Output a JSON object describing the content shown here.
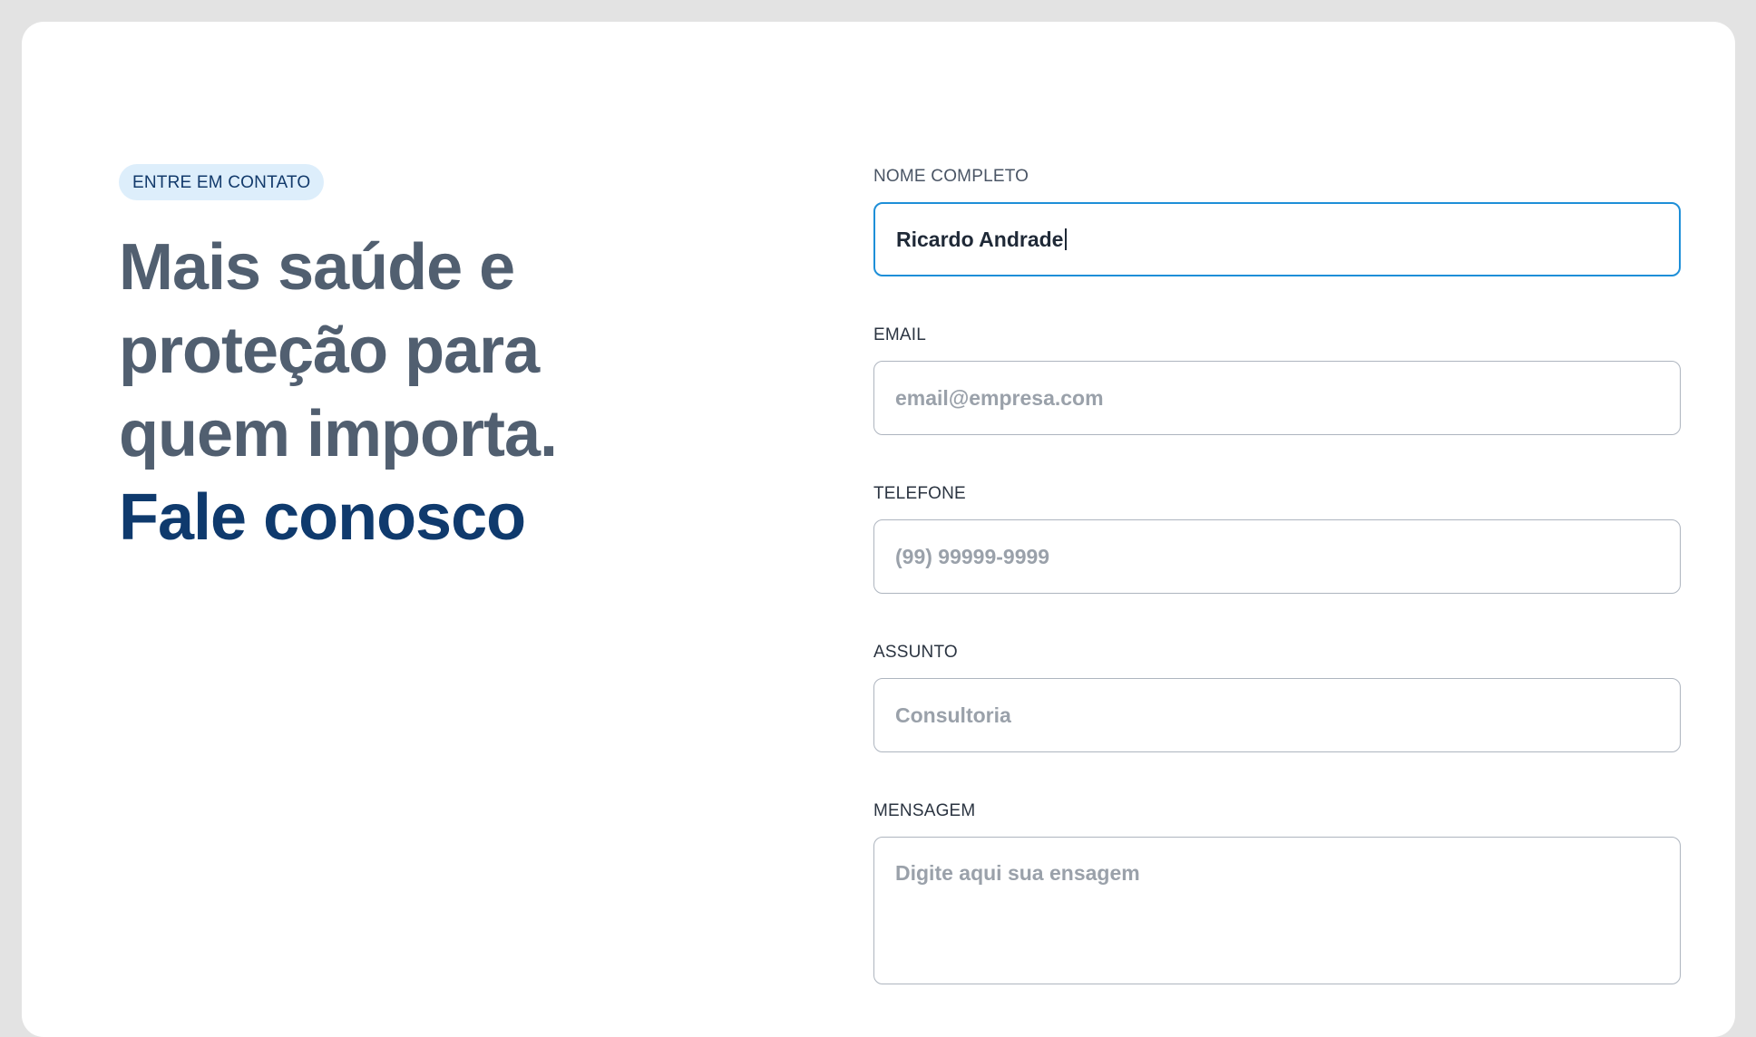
{
  "hero": {
    "badge": "ENTRE EM CONTATO",
    "headline_lines": [
      "Mais saúde e",
      "proteção para",
      "quem importa."
    ],
    "headline_accent": "Fale conosco"
  },
  "form": {
    "name": {
      "label": "NOME COMPLETO",
      "value": "Ricardo Andrade"
    },
    "email": {
      "label": "EMAIL",
      "placeholder": "email@empresa.com"
    },
    "phone": {
      "label": "TELEFONE",
      "placeholder": "(99) 99999-9999"
    },
    "subject": {
      "label": "ASSUNTO",
      "placeholder": "Consultoria"
    },
    "message": {
      "label": "MENSAGEM",
      "placeholder": "Digite aqui sua ensagem"
    }
  },
  "colors": {
    "background": "#e3e3e3",
    "card": "#ffffff",
    "headline": "#515f70",
    "accent": "#0f3a6d",
    "badge_bg": "#ddeefb",
    "focus_border": "#1e8fd8",
    "input_border": "#aeb5bf",
    "placeholder": "#9aa1aa"
  }
}
